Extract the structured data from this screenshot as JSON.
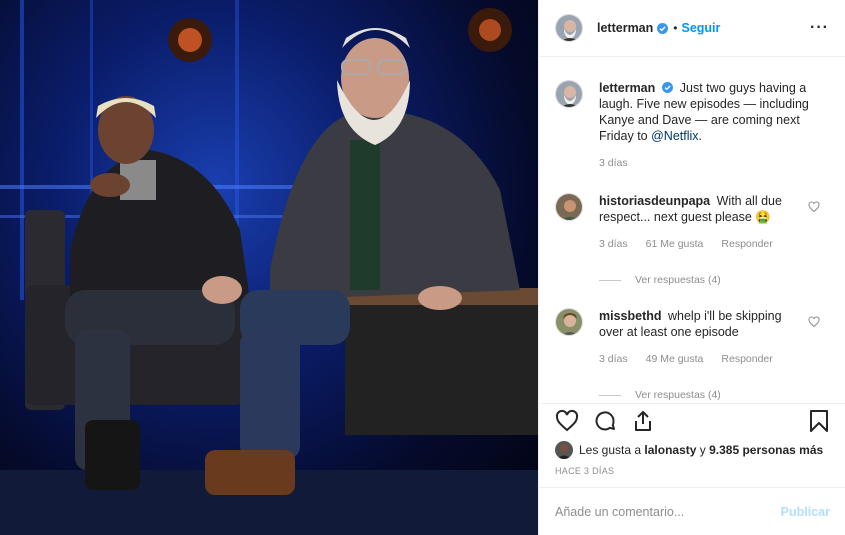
{
  "header": {
    "username": "letterman",
    "separator": "•",
    "follow_label": "Seguir",
    "more_label": "···"
  },
  "caption": {
    "username": "letterman",
    "text": "Just two guys having a laugh. Five new episodes — including Kanye and Dave — are coming next Friday to ",
    "mention": "@Netflix",
    "end": ".",
    "age": "3 días"
  },
  "comments": [
    {
      "username": "historiasdeunpapa",
      "text": "With all due respect... next guest please 🤮",
      "age": "3 días",
      "likes": "61 Me gusta",
      "reply_label": "Responder",
      "view_replies": "Ver respuestas (4)"
    },
    {
      "username": "missbethd",
      "text": "whelp i'll be skipping over at least one episode",
      "age": "3 días",
      "likes": "49 Me gusta",
      "reply_label": "Responder",
      "view_replies": "Ver respuestas (4)"
    }
  ],
  "actions": {
    "like_icon": "heart-icon",
    "comment_icon": "comment-icon",
    "share_icon": "share-icon",
    "save_icon": "bookmark-icon"
  },
  "likes": {
    "prefix": "Les gusta a",
    "user": "lalonasty",
    "middle": "y",
    "count": "9.385 personas más"
  },
  "timestamp": "HACE 3 DÍAS",
  "add_comment": {
    "placeholder": "Añade un comentario...",
    "publish_label": "Publicar"
  },
  "colors": {
    "link": "#0095f6",
    "verified": "#3897f0",
    "publish_disabled": "#b2dffc",
    "muted": "#8e8e8e"
  }
}
